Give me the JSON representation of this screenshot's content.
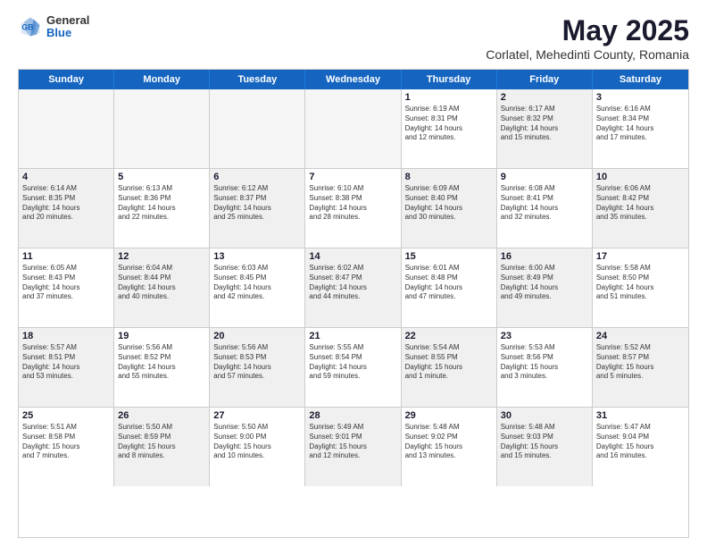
{
  "logo": {
    "general": "General",
    "blue": "Blue"
  },
  "title": "May 2025",
  "subtitle": "Corlatel, Mehedinti County, Romania",
  "header": {
    "days": [
      "Sunday",
      "Monday",
      "Tuesday",
      "Wednesday",
      "Thursday",
      "Friday",
      "Saturday"
    ]
  },
  "weeks": [
    [
      {
        "day": "",
        "empty": true
      },
      {
        "day": "",
        "empty": true
      },
      {
        "day": "",
        "empty": true
      },
      {
        "day": "",
        "empty": true
      },
      {
        "day": "1",
        "lines": [
          "Sunrise: 6:19 AM",
          "Sunset: 8:31 PM",
          "Daylight: 14 hours",
          "and 12 minutes."
        ]
      },
      {
        "day": "2",
        "shaded": true,
        "lines": [
          "Sunrise: 6:17 AM",
          "Sunset: 8:32 PM",
          "Daylight: 14 hours",
          "and 15 minutes."
        ]
      },
      {
        "day": "3",
        "lines": [
          "Sunrise: 6:16 AM",
          "Sunset: 8:34 PM",
          "Daylight: 14 hours",
          "and 17 minutes."
        ]
      }
    ],
    [
      {
        "day": "4",
        "shaded": true,
        "lines": [
          "Sunrise: 6:14 AM",
          "Sunset: 8:35 PM",
          "Daylight: 14 hours",
          "and 20 minutes."
        ]
      },
      {
        "day": "5",
        "lines": [
          "Sunrise: 6:13 AM",
          "Sunset: 8:36 PM",
          "Daylight: 14 hours",
          "and 22 minutes."
        ]
      },
      {
        "day": "6",
        "shaded": true,
        "lines": [
          "Sunrise: 6:12 AM",
          "Sunset: 8:37 PM",
          "Daylight: 14 hours",
          "and 25 minutes."
        ]
      },
      {
        "day": "7",
        "lines": [
          "Sunrise: 6:10 AM",
          "Sunset: 8:38 PM",
          "Daylight: 14 hours",
          "and 28 minutes."
        ]
      },
      {
        "day": "8",
        "shaded": true,
        "lines": [
          "Sunrise: 6:09 AM",
          "Sunset: 8:40 PM",
          "Daylight: 14 hours",
          "and 30 minutes."
        ]
      },
      {
        "day": "9",
        "lines": [
          "Sunrise: 6:08 AM",
          "Sunset: 8:41 PM",
          "Daylight: 14 hours",
          "and 32 minutes."
        ]
      },
      {
        "day": "10",
        "shaded": true,
        "lines": [
          "Sunrise: 6:06 AM",
          "Sunset: 8:42 PM",
          "Daylight: 14 hours",
          "and 35 minutes."
        ]
      }
    ],
    [
      {
        "day": "11",
        "lines": [
          "Sunrise: 6:05 AM",
          "Sunset: 8:43 PM",
          "Daylight: 14 hours",
          "and 37 minutes."
        ]
      },
      {
        "day": "12",
        "shaded": true,
        "lines": [
          "Sunrise: 6:04 AM",
          "Sunset: 8:44 PM",
          "Daylight: 14 hours",
          "and 40 minutes."
        ]
      },
      {
        "day": "13",
        "lines": [
          "Sunrise: 6:03 AM",
          "Sunset: 8:45 PM",
          "Daylight: 14 hours",
          "and 42 minutes."
        ]
      },
      {
        "day": "14",
        "shaded": true,
        "lines": [
          "Sunrise: 6:02 AM",
          "Sunset: 8:47 PM",
          "Daylight: 14 hours",
          "and 44 minutes."
        ]
      },
      {
        "day": "15",
        "lines": [
          "Sunrise: 6:01 AM",
          "Sunset: 8:48 PM",
          "Daylight: 14 hours",
          "and 47 minutes."
        ]
      },
      {
        "day": "16",
        "shaded": true,
        "lines": [
          "Sunrise: 6:00 AM",
          "Sunset: 8:49 PM",
          "Daylight: 14 hours",
          "and 49 minutes."
        ]
      },
      {
        "day": "17",
        "lines": [
          "Sunrise: 5:58 AM",
          "Sunset: 8:50 PM",
          "Daylight: 14 hours",
          "and 51 minutes."
        ]
      }
    ],
    [
      {
        "day": "18",
        "shaded": true,
        "lines": [
          "Sunrise: 5:57 AM",
          "Sunset: 8:51 PM",
          "Daylight: 14 hours",
          "and 53 minutes."
        ]
      },
      {
        "day": "19",
        "lines": [
          "Sunrise: 5:56 AM",
          "Sunset: 8:52 PM",
          "Daylight: 14 hours",
          "and 55 minutes."
        ]
      },
      {
        "day": "20",
        "shaded": true,
        "lines": [
          "Sunrise: 5:56 AM",
          "Sunset: 8:53 PM",
          "Daylight: 14 hours",
          "and 57 minutes."
        ]
      },
      {
        "day": "21",
        "lines": [
          "Sunrise: 5:55 AM",
          "Sunset: 8:54 PM",
          "Daylight: 14 hours",
          "and 59 minutes."
        ]
      },
      {
        "day": "22",
        "shaded": true,
        "lines": [
          "Sunrise: 5:54 AM",
          "Sunset: 8:55 PM",
          "Daylight: 15 hours",
          "and 1 minute."
        ]
      },
      {
        "day": "23",
        "lines": [
          "Sunrise: 5:53 AM",
          "Sunset: 8:56 PM",
          "Daylight: 15 hours",
          "and 3 minutes."
        ]
      },
      {
        "day": "24",
        "shaded": true,
        "lines": [
          "Sunrise: 5:52 AM",
          "Sunset: 8:57 PM",
          "Daylight: 15 hours",
          "and 5 minutes."
        ]
      }
    ],
    [
      {
        "day": "25",
        "lines": [
          "Sunrise: 5:51 AM",
          "Sunset: 8:58 PM",
          "Daylight: 15 hours",
          "and 7 minutes."
        ]
      },
      {
        "day": "26",
        "shaded": true,
        "lines": [
          "Sunrise: 5:50 AM",
          "Sunset: 8:59 PM",
          "Daylight: 15 hours",
          "and 8 minutes."
        ]
      },
      {
        "day": "27",
        "lines": [
          "Sunrise: 5:50 AM",
          "Sunset: 9:00 PM",
          "Daylight: 15 hours",
          "and 10 minutes."
        ]
      },
      {
        "day": "28",
        "shaded": true,
        "lines": [
          "Sunrise: 5:49 AM",
          "Sunset: 9:01 PM",
          "Daylight: 15 hours",
          "and 12 minutes."
        ]
      },
      {
        "day": "29",
        "lines": [
          "Sunrise: 5:48 AM",
          "Sunset: 9:02 PM",
          "Daylight: 15 hours",
          "and 13 minutes."
        ]
      },
      {
        "day": "30",
        "shaded": true,
        "lines": [
          "Sunrise: 5:48 AM",
          "Sunset: 9:03 PM",
          "Daylight: 15 hours",
          "and 15 minutes."
        ]
      },
      {
        "day": "31",
        "lines": [
          "Sunrise: 5:47 AM",
          "Sunset: 9:04 PM",
          "Daylight: 15 hours",
          "and 16 minutes."
        ]
      }
    ]
  ]
}
